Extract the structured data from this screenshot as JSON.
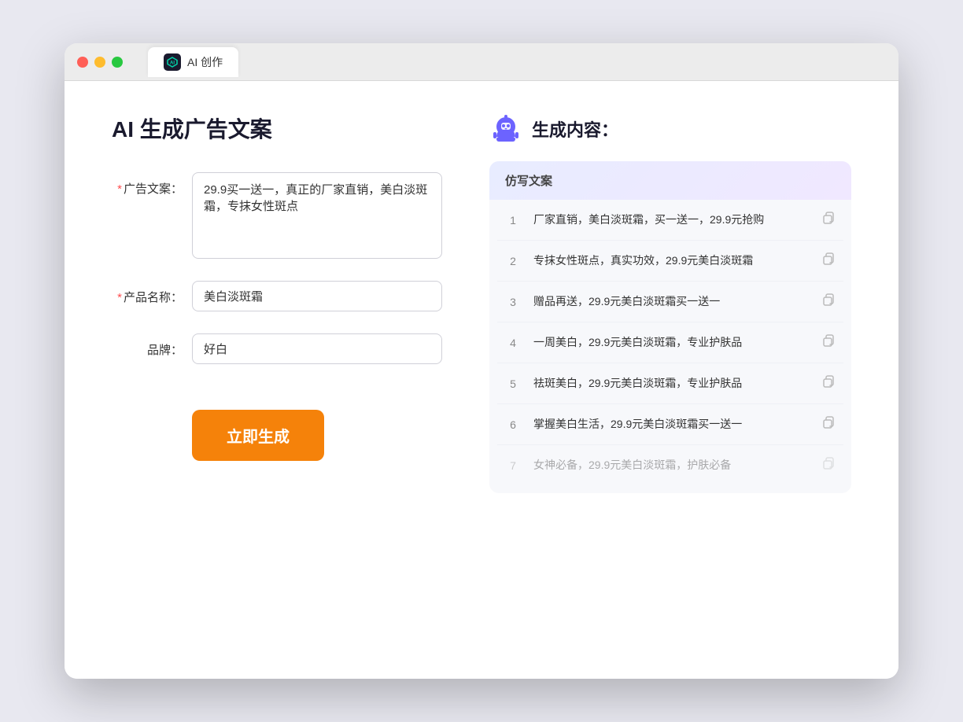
{
  "window": {
    "tab_label": "AI 创作"
  },
  "left": {
    "page_title": "AI 生成广告文案",
    "fields": [
      {
        "id": "ad_copy",
        "label": "广告文案：",
        "required": true,
        "type": "textarea",
        "value": "29.9买一送一，真正的厂家直销，美白淡斑霜，专抹女性斑点",
        "placeholder": ""
      },
      {
        "id": "product_name",
        "label": "产品名称：",
        "required": true,
        "type": "input",
        "value": "美白淡斑霜",
        "placeholder": ""
      },
      {
        "id": "brand",
        "label": "品牌：",
        "required": false,
        "type": "input",
        "value": "好白",
        "placeholder": ""
      }
    ],
    "generate_btn": "立即生成"
  },
  "right": {
    "title": "生成内容：",
    "table_header": "仿写文案",
    "results": [
      {
        "num": "1",
        "text": "厂家直销，美白淡斑霜，买一送一，29.9元抢购",
        "faded": false
      },
      {
        "num": "2",
        "text": "专抹女性斑点，真实功效，29.9元美白淡斑霜",
        "faded": false
      },
      {
        "num": "3",
        "text": "赠品再送，29.9元美白淡斑霜买一送一",
        "faded": false
      },
      {
        "num": "4",
        "text": "一周美白，29.9元美白淡斑霜，专业护肤品",
        "faded": false
      },
      {
        "num": "5",
        "text": "祛斑美白，29.9元美白淡斑霜，专业护肤品",
        "faded": false
      },
      {
        "num": "6",
        "text": "掌握美白生活，29.9元美白淡斑霜买一送一",
        "faded": false
      },
      {
        "num": "7",
        "text": "女神必备，29.9元美白淡斑霜，护肤必备",
        "faded": true
      }
    ]
  }
}
